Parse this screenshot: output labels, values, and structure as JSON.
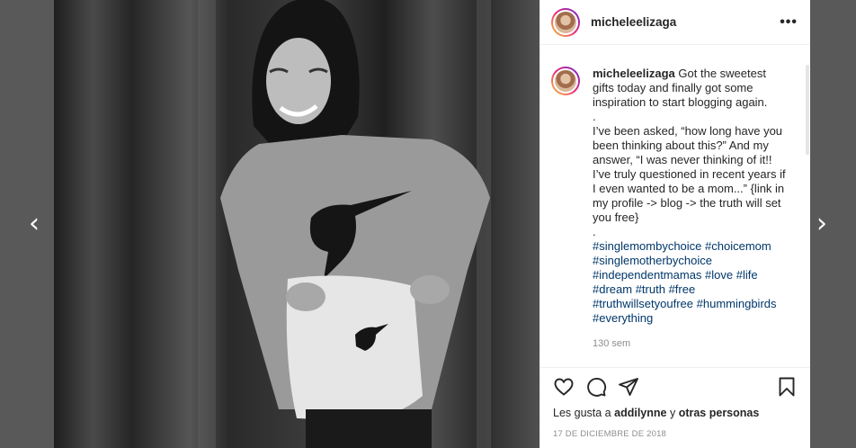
{
  "post": {
    "username": "micheleelizaga",
    "caption_lines": [
      "Got the sweetest gifts today and finally got some inspiration to start blogging again.",
      ".",
      "I’ve been asked, “how long have you been thinking about this?” And my answer, “I was never thinking of it!! I’ve truly questioned in recent years if I even wanted to be a mom...” {link in my profile -> blog -> the truth will set you free}",
      "."
    ],
    "hashtags": [
      "#singlemombychoice",
      "#choicemom",
      "#singlemotherbychoice",
      "#independentmamas",
      "#love",
      "#life",
      "#dream",
      "#truth",
      "#free",
      "#truthwillsetyoufree",
      "#hummingbirds",
      "#everything"
    ],
    "age": "130 sem",
    "likes_prefix": "Les gusta a",
    "likes_user": "addilynne",
    "likes_conj": "y",
    "likes_others": "otras personas",
    "date": "17 DE DICIEMBRE DE 2018"
  },
  "nav": {
    "prev": "‹",
    "next": "›"
  },
  "header": {
    "more": "•••"
  },
  "icons": {
    "like": "heart-icon",
    "comment": "comment-icon",
    "share": "share-icon",
    "save": "bookmark-icon",
    "more": "more-options-icon"
  }
}
